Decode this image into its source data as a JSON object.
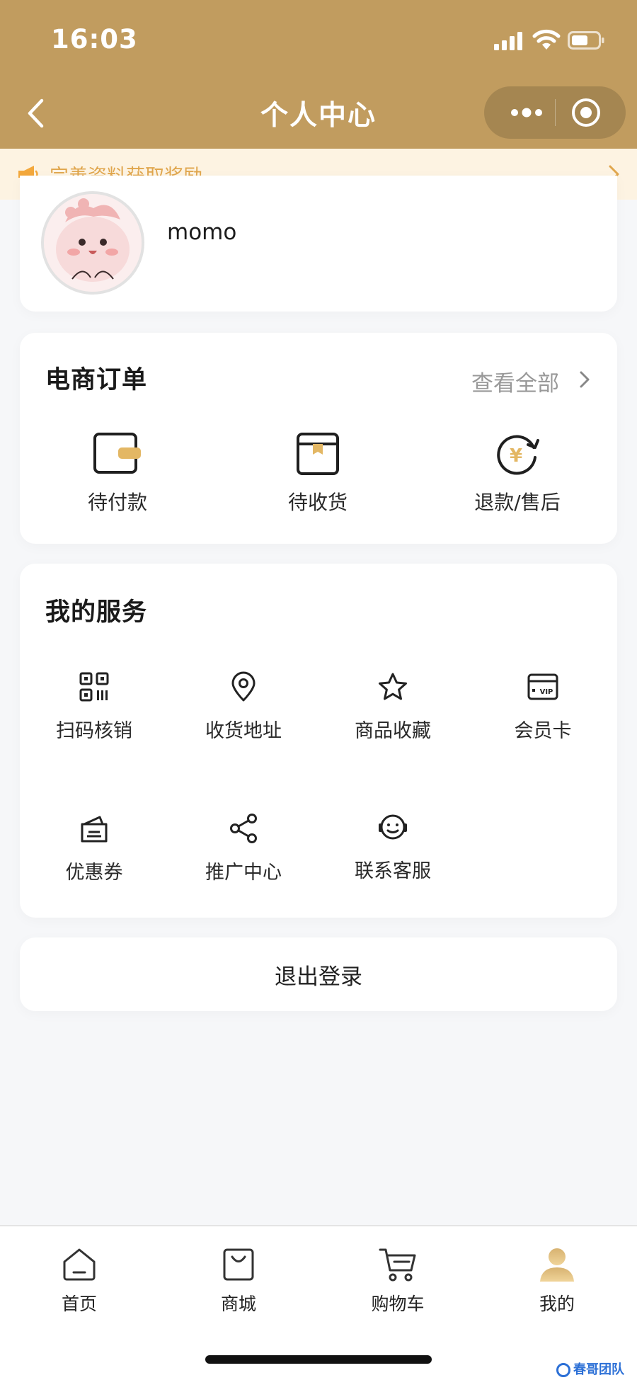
{
  "status_bar": {
    "time": "16:03"
  },
  "nav": {
    "title": "个人中心"
  },
  "notice": {
    "text": "完善资料获取奖励"
  },
  "profile": {
    "username": "momo"
  },
  "orders": {
    "title": "电商订单",
    "see_all": "查看全部",
    "items": [
      {
        "label": "待付款",
        "icon": "wallet-icon"
      },
      {
        "label": "待收货",
        "icon": "package-box-icon"
      },
      {
        "label": "退款/售后",
        "icon": "refund-yen-icon"
      }
    ]
  },
  "services": {
    "title": "我的服务",
    "items": [
      {
        "label": "扫码核销",
        "icon": "qr-scan-icon"
      },
      {
        "label": "收货地址",
        "icon": "location-pin-icon"
      },
      {
        "label": "商品收藏",
        "icon": "star-icon"
      },
      {
        "label": "会员卡",
        "icon": "vip-card-icon",
        "badge": "VIP"
      },
      {
        "label": "优惠券",
        "icon": "coupon-icon"
      },
      {
        "label": "推广中心",
        "icon": "share-icon"
      },
      {
        "label": "联系客服",
        "icon": "customer-service-icon"
      }
    ]
  },
  "logout": {
    "label": "退出登录"
  },
  "tabbar": {
    "items": [
      {
        "label": "首页",
        "icon": "home-icon"
      },
      {
        "label": "商城",
        "icon": "shopping-bag-icon"
      },
      {
        "label": "购物车",
        "icon": "cart-icon"
      },
      {
        "label": "我的",
        "icon": "user-icon",
        "active": true
      }
    ]
  },
  "watermark": {
    "text": "春哥团队"
  },
  "colors": {
    "brand": "#c19c5f",
    "notice_bg": "#fdf3e2",
    "notice_text": "#e0a64d",
    "accent_gold": "#e0b15a"
  }
}
